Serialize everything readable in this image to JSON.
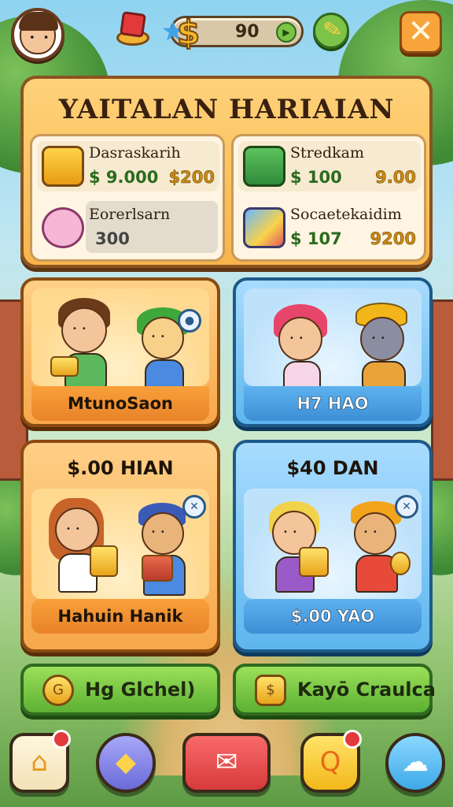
{
  "header": {
    "currency_value": "90",
    "play_icon": "play-icon",
    "close_label": "✕"
  },
  "daily": {
    "title": "YAITALAN HARIAIAN",
    "tasks": [
      {
        "name": "Dasraskarih",
        "value_a": "$ 9.000",
        "value_b": "$200",
        "icon": "gold-bars-icon"
      },
      {
        "name": "Stredkam",
        "value_a": "$ 100",
        "value_b": "9.00",
        "icon": "ticket-icon"
      },
      {
        "name": "Eorerlsarn",
        "value_a": "300",
        "icon": "pet-icon"
      },
      {
        "name": "Socaetekaidim",
        "value_a": "$ 107",
        "value_b": "9200",
        "icon": "crayon-icon"
      }
    ]
  },
  "shop": {
    "cards": [
      {
        "label": "MtunoSaon",
        "price": ""
      },
      {
        "label": "H7 HAO",
        "price": ""
      },
      {
        "label": "Hahuin Hanik",
        "price": "$.00 HIAN"
      },
      {
        "label": "$.00 YAO",
        "price": "$40 DAN"
      }
    ]
  },
  "actions": [
    {
      "label": "Hg Glchel)",
      "icon": "coin-icon"
    },
    {
      "label": "Kayō Craulca",
      "icon": "scroll-icon"
    }
  ],
  "nav": [
    {
      "icon": "home-icon",
      "color": "#ffd45a",
      "badge": true
    },
    {
      "icon": "kite-icon",
      "color": "#8a8ae8",
      "badge": false
    },
    {
      "icon": "chat-icon",
      "color": "#e84a4a",
      "badge": false
    },
    {
      "icon": "quest-icon",
      "color": "#ffd02a",
      "badge": true
    },
    {
      "icon": "cloud-icon",
      "color": "#5ebcf0",
      "badge": false
    }
  ],
  "colors": {
    "panel_orange": "#f8b44a",
    "card_blue": "#5eb6ee",
    "button_green": "#5cb032",
    "close_orange": "#f7a43a"
  }
}
